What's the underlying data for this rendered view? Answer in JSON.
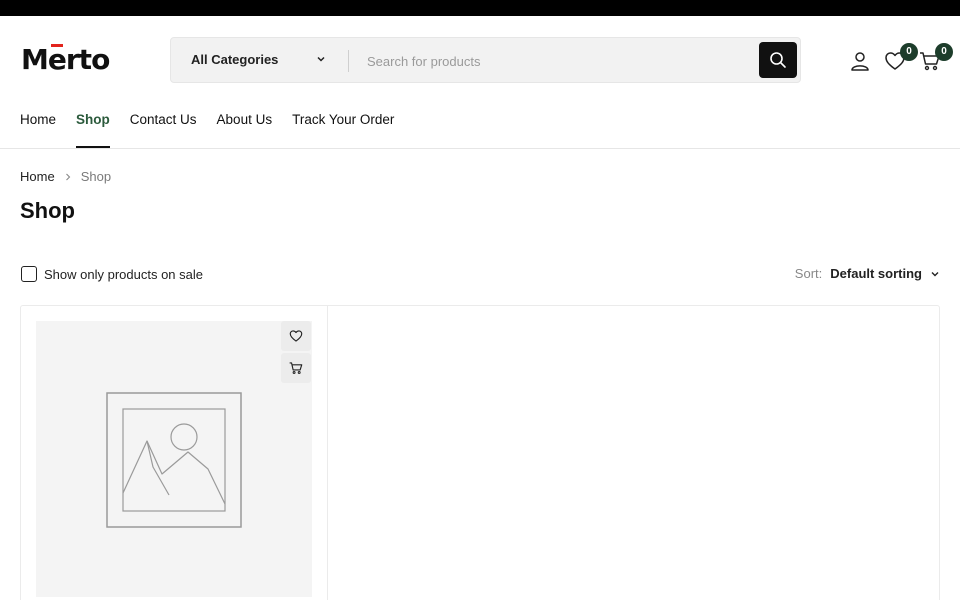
{
  "brand": {
    "logo_pre": "M",
    "logo_accent": "e",
    "logo_post": "rto"
  },
  "search": {
    "category": "All Categories",
    "placeholder": "Search for products",
    "value": ""
  },
  "header_icons": {
    "wishlist_count": "0",
    "cart_count": "0"
  },
  "nav": [
    {
      "label": "Home",
      "active": false
    },
    {
      "label": "Shop",
      "active": true
    },
    {
      "label": "Contact Us",
      "active": false
    },
    {
      "label": "About Us",
      "active": false
    },
    {
      "label": "Track Your Order",
      "active": false
    }
  ],
  "breadcrumb": {
    "home": "Home",
    "current": "Shop"
  },
  "page_title": "Shop",
  "filters": {
    "sale_label": "Show only products on sale",
    "sale_checked": false,
    "sort_label": "Sort:",
    "sort_value": "Default sorting"
  },
  "colors": {
    "accent_green": "#2b5a3c",
    "badge_bg": "#1d3d2b",
    "logo_red": "#e2241d"
  },
  "icons": [
    "user-icon",
    "heart-icon",
    "cart-icon",
    "search-icon",
    "chevron-down-icon",
    "chevron-right-icon",
    "image-placeholder-icon"
  ]
}
